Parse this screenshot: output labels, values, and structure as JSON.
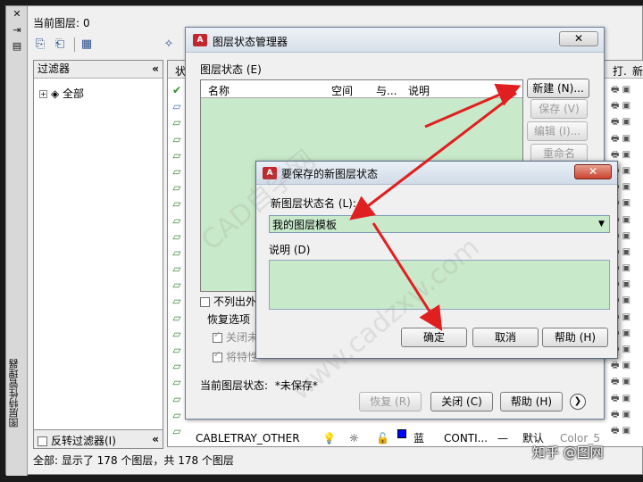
{
  "lpm": {
    "vertical_title": "图层特性管理器",
    "current_layer_label": "当前图层:",
    "current_layer_value": "0",
    "filters_header": "过滤器",
    "tree_all": "全部",
    "invert_filter": "反转过滤器(I)",
    "grid_headers": {
      "status": "状...",
      "plot": "打.",
      "new": "新."
    },
    "last_row": {
      "name": "CABLETRAY_OTHER",
      "color_name": "蓝",
      "linetype": "CONTI...",
      "lineweight": "默认",
      "plot_style": "Color_5"
    },
    "status_text": "全部: 显示了 178 个图层，共 178 个图层"
  },
  "lsm": {
    "title": "图层状态管理器",
    "section_label": "图层状态 (E)",
    "columns": [
      "名称",
      "空间",
      "与...",
      "说明"
    ],
    "buttons": {
      "new": "新建 (N)...",
      "save": "保存 (V)",
      "edit": "编辑 (I)...",
      "rename": "重命名"
    },
    "no_list_label": "不列出外",
    "restore_options": "恢复选项",
    "opt1": "关闭未",
    "opt2": "将特性",
    "current_state_label": "当前图层状态:",
    "current_state_value": "*未保存*",
    "bottom_buttons": {
      "restore": "恢复 (R)",
      "close": "关闭 (C)",
      "help": "帮助 (H)"
    }
  },
  "nls": {
    "title": "要保存的新图层状态",
    "name_label": "新图层状态名 (L):",
    "name_value": "我的图层模板",
    "desc_label": "说明 (D)",
    "desc_value": "",
    "ok": "确定",
    "cancel": "取消",
    "help": "帮助 (H)"
  },
  "watermarks": [
    "CAD自学网",
    "www.cadzxw.com"
  ],
  "corner_watermark": "知乎 @图网",
  "colors": {
    "layer_blue": "#0000ff",
    "arrow_red": "#e02020",
    "grid_green": "#c9e9cb"
  }
}
